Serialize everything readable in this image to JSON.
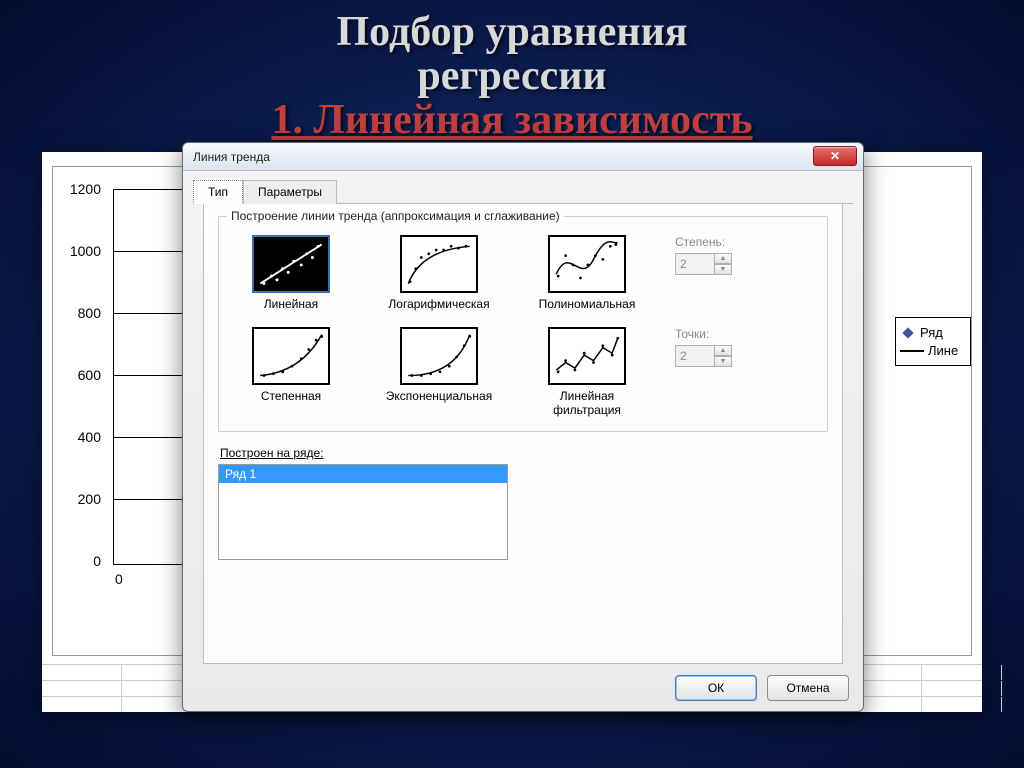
{
  "slide": {
    "title_line1": "Подбор  уравнения",
    "title_line2": "регрессии",
    "title_line3": "1. Линейная зависимость"
  },
  "chart": {
    "y_ticks": [
      "1200",
      "1000",
      "800",
      "600",
      "400",
      "200",
      "0"
    ],
    "x_zero": "0",
    "legend_series": "Ряд",
    "legend_line": "Лине"
  },
  "dialog": {
    "title": "Линия тренда",
    "tab_type": "Тип",
    "tab_params": "Параметры",
    "group_title": "Построение линии тренда (аппроксимация и сглаживание)",
    "types": {
      "linear": "Линейная",
      "log": "Логарифмическая",
      "poly": "Полиномиальная",
      "power": "Степенная",
      "exp": "Экспоненциальная",
      "movavg": "Линейная фильтрация"
    },
    "degree_label": "Степень:",
    "degree_value": "2",
    "period_label": "Точки:",
    "period_value": "2",
    "series_label": "Построен на ряде:",
    "series_item": "Ряд 1",
    "ok": "ОК",
    "cancel": "Отмена"
  },
  "chart_data": {
    "type": "scatter",
    "title": "",
    "xlabel": "",
    "ylabel": "",
    "ylim": [
      0,
      1200
    ],
    "y_ticks": [
      0,
      200,
      400,
      600,
      800,
      1000,
      1200
    ],
    "series": [
      {
        "name": "Ряд 1",
        "note": "data points obscured by dialog; only y-axis and legend visible"
      }
    ],
    "trendline": {
      "type": "linear",
      "name": "Линейная"
    }
  }
}
